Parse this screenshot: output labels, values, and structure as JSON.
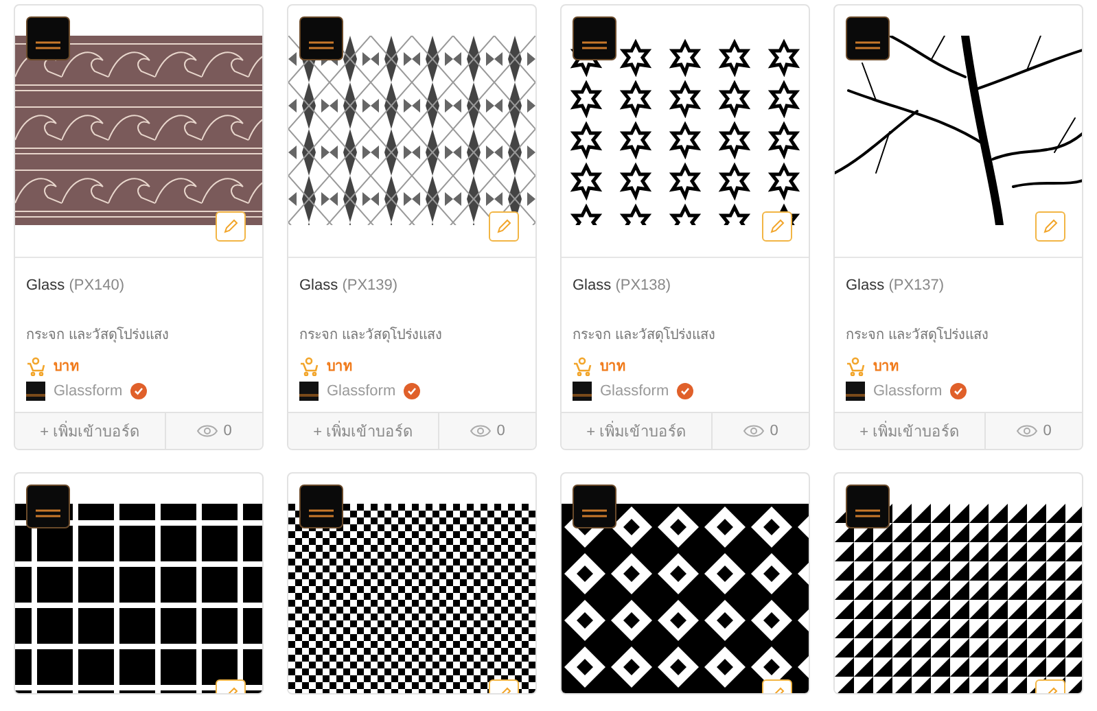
{
  "cards": [
    {
      "kind": "waves",
      "name": "Glass",
      "code": "(PX140)",
      "description": "กระจก และวัสดุโปร่งแสง",
      "price": "บาท",
      "brand": "Glassform",
      "verified": true,
      "add_label": "+ เพิ่มเข้าบอร์ด",
      "views": "0"
    },
    {
      "kind": "prisms",
      "name": "Glass",
      "code": "(PX139)",
      "description": "กระจก และวัสดุโปร่งแสง",
      "price": "บาท",
      "brand": "Glassform",
      "verified": true,
      "add_label": "+ เพิ่มเข้าบอร์ด",
      "views": "0"
    },
    {
      "kind": "stars",
      "name": "Glass",
      "code": "(PX138)",
      "description": "กระจก และวัสดุโปร่งแสง",
      "price": "บาท",
      "brand": "Glassform",
      "verified": true,
      "add_label": "+ เพิ่มเข้าบอร์ด",
      "views": "0"
    },
    {
      "kind": "branches",
      "name": "Glass",
      "code": "(PX137)",
      "description": "กระจก และวัสดุโปร่งแสง",
      "price": "บาท",
      "brand": "Glassform",
      "verified": true,
      "add_label": "+ เพิ่มเข้าบอร์ด",
      "views": "0"
    },
    {
      "kind": "octagons"
    },
    {
      "kind": "checker"
    },
    {
      "kind": "diamonds"
    },
    {
      "kind": "triangles"
    }
  ]
}
